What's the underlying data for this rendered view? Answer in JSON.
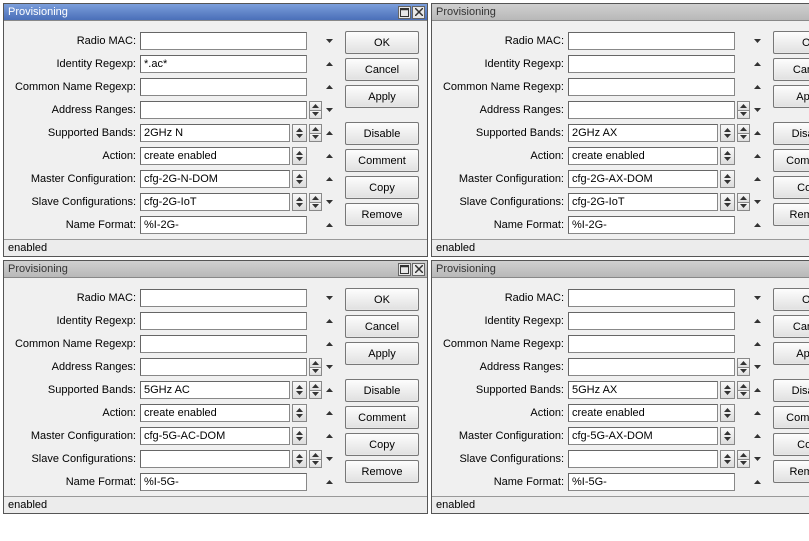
{
  "windows": [
    {
      "title": "Provisioning",
      "active": true,
      "fields": {
        "radio_mac": "",
        "identity_regexp": "*.ac*",
        "common_name_regexp": "",
        "address_ranges": "",
        "supported_bands": "2GHz N",
        "action": "create enabled",
        "master_config": "cfg-2G-N-DOM",
        "slave_config": "cfg-2G-IoT",
        "name_format": "%I-2G-"
      },
      "status": "enabled"
    },
    {
      "title": "Provisioning",
      "active": false,
      "fields": {
        "radio_mac": "",
        "identity_regexp": "",
        "common_name_regexp": "",
        "address_ranges": "",
        "supported_bands": "2GHz AX",
        "action": "create enabled",
        "master_config": "cfg-2G-AX-DOM",
        "slave_config": "cfg-2G-IoT",
        "name_format": "%I-2G-"
      },
      "status": "enabled"
    },
    {
      "title": "Provisioning",
      "active": false,
      "fields": {
        "radio_mac": "",
        "identity_regexp": "",
        "common_name_regexp": "",
        "address_ranges": "",
        "supported_bands": "5GHz AC",
        "action": "create enabled",
        "master_config": "cfg-5G-AC-DOM",
        "slave_config": "",
        "name_format": "%I-5G-"
      },
      "status": "enabled"
    },
    {
      "title": "Provisioning",
      "active": false,
      "fields": {
        "radio_mac": "",
        "identity_regexp": "",
        "common_name_regexp": "",
        "address_ranges": "",
        "supported_bands": "5GHz AX",
        "action": "create enabled",
        "master_config": "cfg-5G-AX-DOM",
        "slave_config": "",
        "name_format": "%I-5G-"
      },
      "status": "enabled"
    }
  ],
  "labels": {
    "radio_mac": "Radio MAC:",
    "identity_regexp": "Identity Regexp:",
    "common_name_regexp": "Common Name Regexp:",
    "address_ranges": "Address Ranges:",
    "supported_bands": "Supported Bands:",
    "action": "Action:",
    "master_config": "Master Configuration:",
    "slave_config": "Slave Configurations:",
    "name_format": "Name Format:"
  },
  "buttons": {
    "ok": "OK",
    "cancel": "Cancel",
    "apply": "Apply",
    "disable": "Disable",
    "comment": "Comment",
    "copy": "Copy",
    "remove": "Remove"
  }
}
